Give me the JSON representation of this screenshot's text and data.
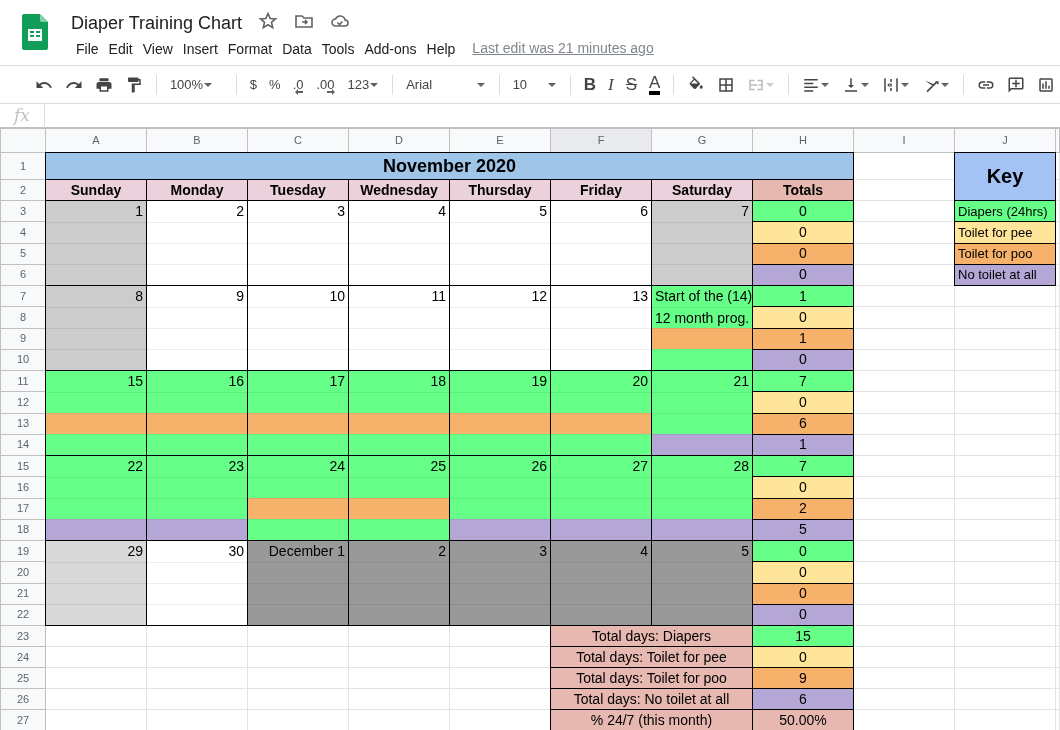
{
  "document": {
    "title": "Diaper Training Chart",
    "last_edit": "Last edit was 21 minutes ago"
  },
  "menu": [
    "File",
    "Edit",
    "View",
    "Insert",
    "Format",
    "Data",
    "Tools",
    "Add-ons",
    "Help"
  ],
  "toolbar": {
    "zoom": "100%",
    "number_formats": [
      "$",
      "%",
      ".0",
      ".00",
      "123"
    ],
    "font": "Arial",
    "font_size": "10",
    "text_styles": [
      "B",
      "I",
      "S",
      "A"
    ],
    "merge_disabled": true
  },
  "formula_bar": {
    "label": "fx"
  },
  "columns": [
    {
      "label": "A",
      "selected": false
    },
    {
      "label": "B",
      "selected": false
    },
    {
      "label": "C",
      "selected": false
    },
    {
      "label": "D",
      "selected": false
    },
    {
      "label": "E",
      "selected": false
    },
    {
      "label": "F",
      "selected": true
    },
    {
      "label": "G",
      "selected": false
    },
    {
      "label": "H",
      "selected": false
    },
    {
      "label": "I",
      "selected": false
    },
    {
      "label": "J",
      "selected": false
    }
  ],
  "rows": [
    "1",
    "2",
    "3",
    "4",
    "5",
    "6",
    "7",
    "8",
    "9",
    "10",
    "11",
    "12",
    "13",
    "14",
    "15",
    "16",
    "17",
    "18",
    "19",
    "20",
    "21",
    "22",
    "23",
    "24",
    "25",
    "26",
    "27"
  ],
  "calendar": {
    "title": "November 2020",
    "weekdays": [
      "Sunday",
      "Monday",
      "Tuesday",
      "Wednesday",
      "Thursday",
      "Friday",
      "Saturday"
    ],
    "totals_heading": "Totals",
    "weeks": [
      {
        "days": [
          {
            "label": "1",
            "slots": [
              {
                "kind": "weekend"
              },
              {
                "kind": "weekend"
              },
              {
                "kind": "weekend"
              },
              {
                "kind": "weekend"
              }
            ]
          },
          {
            "label": "2",
            "slots": [
              {
                "kind": "blank"
              },
              {
                "kind": "blank"
              },
              {
                "kind": "blank"
              },
              {
                "kind": "blank"
              }
            ]
          },
          {
            "label": "3",
            "slots": [
              {
                "kind": "blank"
              },
              {
                "kind": "blank"
              },
              {
                "kind": "blank"
              },
              {
                "kind": "blank"
              }
            ]
          },
          {
            "label": "4",
            "slots": [
              {
                "kind": "blank"
              },
              {
                "kind": "blank"
              },
              {
                "kind": "blank"
              },
              {
                "kind": "blank"
              }
            ]
          },
          {
            "label": "5",
            "slots": [
              {
                "kind": "blank"
              },
              {
                "kind": "blank"
              },
              {
                "kind": "blank"
              },
              {
                "kind": "blank"
              }
            ]
          },
          {
            "label": "6",
            "slots": [
              {
                "kind": "blank"
              },
              {
                "kind": "blank"
              },
              {
                "kind": "blank"
              },
              {
                "kind": "blank"
              }
            ]
          },
          {
            "label": "7",
            "slots": [
              {
                "kind": "weekend"
              },
              {
                "kind": "weekend"
              },
              {
                "kind": "weekend"
              },
              {
                "kind": "weekend"
              }
            ]
          }
        ],
        "totals": [
          "0",
          "0",
          "0",
          "0"
        ]
      },
      {
        "days": [
          {
            "label": "8",
            "slots": [
              {
                "kind": "weekend"
              },
              {
                "kind": "weekend"
              },
              {
                "kind": "weekend"
              },
              {
                "kind": "weekend"
              }
            ]
          },
          {
            "label": "9",
            "slots": [
              {
                "kind": "blank"
              },
              {
                "kind": "blank"
              },
              {
                "kind": "blank"
              },
              {
                "kind": "blank"
              }
            ]
          },
          {
            "label": "10",
            "slots": [
              {
                "kind": "blank"
              },
              {
                "kind": "blank"
              },
              {
                "kind": "blank"
              },
              {
                "kind": "blank"
              }
            ]
          },
          {
            "label": "11",
            "slots": [
              {
                "kind": "blank"
              },
              {
                "kind": "blank"
              },
              {
                "kind": "blank"
              },
              {
                "kind": "blank"
              }
            ]
          },
          {
            "label": "12",
            "slots": [
              {
                "kind": "blank"
              },
              {
                "kind": "blank"
              },
              {
                "kind": "blank"
              },
              {
                "kind": "blank"
              }
            ]
          },
          {
            "label": "13",
            "slots": [
              {
                "kind": "blank"
              },
              {
                "kind": "blank"
              },
              {
                "kind": "blank"
              },
              {
                "kind": "blank"
              }
            ]
          },
          {
            "notes": [
              "Start of the  (14)",
              "12 month prog."
            ],
            "slots": [
              {
                "kind": "diaper"
              },
              {
                "kind": "diaper"
              },
              {
                "kind": "poo"
              },
              {
                "kind": "diaper"
              }
            ]
          }
        ],
        "totals": [
          "1",
          "0",
          "1",
          "0"
        ]
      },
      {
        "days": [
          {
            "label": "15",
            "slots": [
              {
                "kind": "diaper"
              },
              {
                "kind": "diaper"
              },
              {
                "kind": "poo"
              },
              {
                "kind": "diaper"
              }
            ]
          },
          {
            "label": "16",
            "slots": [
              {
                "kind": "diaper"
              },
              {
                "kind": "diaper"
              },
              {
                "kind": "poo"
              },
              {
                "kind": "diaper"
              }
            ]
          },
          {
            "label": "17",
            "slots": [
              {
                "kind": "diaper"
              },
              {
                "kind": "diaper"
              },
              {
                "kind": "poo"
              },
              {
                "kind": "diaper"
              }
            ]
          },
          {
            "label": "18",
            "slots": [
              {
                "kind": "diaper"
              },
              {
                "kind": "diaper"
              },
              {
                "kind": "poo"
              },
              {
                "kind": "diaper"
              }
            ]
          },
          {
            "label": "19",
            "slots": [
              {
                "kind": "diaper"
              },
              {
                "kind": "diaper"
              },
              {
                "kind": "poo"
              },
              {
                "kind": "diaper"
              }
            ]
          },
          {
            "label": "20",
            "slots": [
              {
                "kind": "diaper"
              },
              {
                "kind": "diaper"
              },
              {
                "kind": "poo"
              },
              {
                "kind": "diaper"
              }
            ]
          },
          {
            "label": "21",
            "slots": [
              {
                "kind": "diaper"
              },
              {
                "kind": "diaper"
              },
              {
                "kind": "diaper"
              },
              {
                "kind": "none"
              }
            ]
          }
        ],
        "totals": [
          "7",
          "0",
          "6",
          "1"
        ]
      },
      {
        "days": [
          {
            "label": "22",
            "slots": [
              {
                "kind": "diaper"
              },
              {
                "kind": "diaper"
              },
              {
                "kind": "diaper"
              },
              {
                "kind": "none"
              }
            ]
          },
          {
            "label": "23",
            "slots": [
              {
                "kind": "diaper"
              },
              {
                "kind": "diaper"
              },
              {
                "kind": "diaper"
              },
              {
                "kind": "none"
              }
            ]
          },
          {
            "label": "24",
            "slots": [
              {
                "kind": "diaper"
              },
              {
                "kind": "diaper"
              },
              {
                "kind": "poo"
              },
              {
                "kind": "diaper"
              }
            ]
          },
          {
            "label": "25",
            "slots": [
              {
                "kind": "diaper"
              },
              {
                "kind": "diaper"
              },
              {
                "kind": "poo"
              },
              {
                "kind": "diaper"
              }
            ]
          },
          {
            "label": "26",
            "slots": [
              {
                "kind": "diaper"
              },
              {
                "kind": "diaper"
              },
              {
                "kind": "diaper"
              },
              {
                "kind": "none"
              }
            ]
          },
          {
            "label": "27",
            "slots": [
              {
                "kind": "diaper"
              },
              {
                "kind": "diaper"
              },
              {
                "kind": "diaper"
              },
              {
                "kind": "none"
              }
            ]
          },
          {
            "label": "28",
            "slots": [
              {
                "kind": "diaper"
              },
              {
                "kind": "diaper"
              },
              {
                "kind": "diaper"
              },
              {
                "kind": "none"
              }
            ]
          }
        ],
        "totals": [
          "7",
          "0",
          "2",
          "5"
        ]
      },
      {
        "days": [
          {
            "label": "29",
            "slots": [
              {
                "kind": "shaded"
              },
              {
                "kind": "shaded"
              },
              {
                "kind": "shaded"
              },
              {
                "kind": "shaded"
              }
            ]
          },
          {
            "label": "30",
            "slots": [
              {
                "kind": "blank"
              },
              {
                "kind": "blank"
              },
              {
                "kind": "blank"
              },
              {
                "kind": "blank"
              }
            ]
          },
          {
            "label": "December 1",
            "slots": [
              {
                "kind": "next-month"
              },
              {
                "kind": "next-month"
              },
              {
                "kind": "next-month"
              },
              {
                "kind": "next-month"
              }
            ]
          },
          {
            "label": "2",
            "slots": [
              {
                "kind": "next-month"
              },
              {
                "kind": "next-month"
              },
              {
                "kind": "next-month"
              },
              {
                "kind": "next-month"
              }
            ]
          },
          {
            "label": "3",
            "slots": [
              {
                "kind": "next-month"
              },
              {
                "kind": "next-month"
              },
              {
                "kind": "next-month"
              },
              {
                "kind": "next-month"
              }
            ]
          },
          {
            "label": "4",
            "slots": [
              {
                "kind": "next-month"
              },
              {
                "kind": "next-month"
              },
              {
                "kind": "next-month"
              },
              {
                "kind": "next-month"
              }
            ]
          },
          {
            "label": "5",
            "slots": [
              {
                "kind": "next-month"
              },
              {
                "kind": "next-month"
              },
              {
                "kind": "next-month"
              },
              {
                "kind": "next-month"
              }
            ]
          }
        ],
        "totals": [
          "0",
          "0",
          "0",
          "0"
        ]
      }
    ]
  },
  "summary": [
    {
      "label": "Total days: Diapers",
      "value": "15",
      "kind": "diaper"
    },
    {
      "label": "Total days: Toilet for pee",
      "value": "0",
      "kind": "pee"
    },
    {
      "label": "Total days: Toilet for poo",
      "value": "9",
      "kind": "poo"
    },
    {
      "label": "Total days: No toilet at all",
      "value": "6",
      "kind": "none"
    },
    {
      "label": "% 24/7 (this month)",
      "value": "50.00%",
      "kind": "percent"
    }
  ],
  "key": {
    "title": "Key",
    "items": [
      {
        "label": "Diapers (24hrs)",
        "kind": "diaper",
        "color": "#66ff88"
      },
      {
        "label": "Toilet for pee",
        "kind": "pee",
        "color": "#ffe599"
      },
      {
        "label": "Toilet for poo",
        "kind": "poo",
        "color": "#f6b26b"
      },
      {
        "label": "No toilet at all",
        "kind": "none",
        "color": "#b4a7d6"
      }
    ]
  }
}
